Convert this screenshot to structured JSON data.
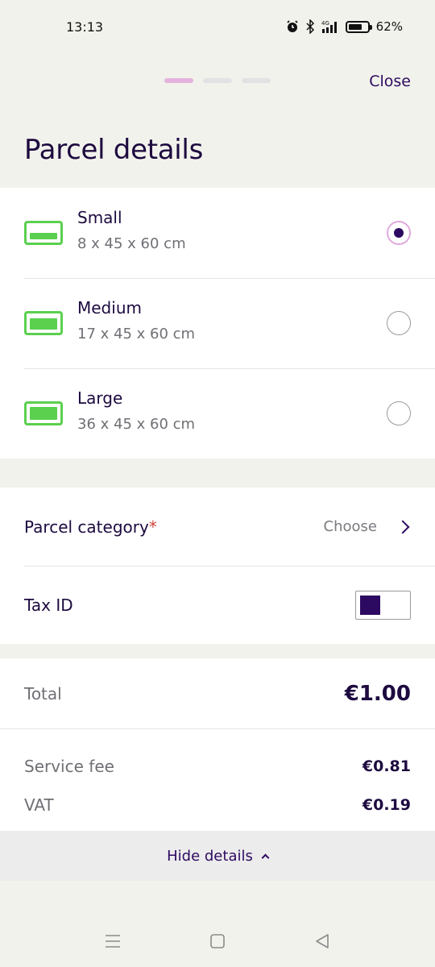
{
  "status_bar": {
    "time": "13:13",
    "battery": "62%",
    "icons": [
      "alarm-icon",
      "bluetooth-icon",
      "signal-4g-icon",
      "battery-icon"
    ]
  },
  "header": {
    "close_label": "Close",
    "steps_total": 3,
    "active_step": 1,
    "title": "Parcel details"
  },
  "sizes": [
    {
      "name": "Small",
      "dims": "8 x 45 x 60 cm",
      "selected": true
    },
    {
      "name": "Medium",
      "dims": "17 x 45 x 60 cm",
      "selected": false
    },
    {
      "name": "Large",
      "dims": "36 x 45 x 60 cm",
      "selected": false
    }
  ],
  "details": {
    "category_label": "Parcel category",
    "required_mark": "*",
    "category_value": "Choose",
    "tax_id_label": "Tax ID",
    "tax_id_enabled": false
  },
  "totals": {
    "total_label": "Total",
    "total_value": "€1.00",
    "service_fee_label": "Service fee",
    "service_fee_value": "€0.81",
    "vat_label": "VAT",
    "vat_value": "€0.19"
  },
  "hide_details_label": "Hide details",
  "colors": {
    "accent": "#2d0a61",
    "step_active": "#e4b3dd",
    "box_green": "#5bd04f",
    "required_red": "#d0443f",
    "background": "#f2f2ec"
  }
}
